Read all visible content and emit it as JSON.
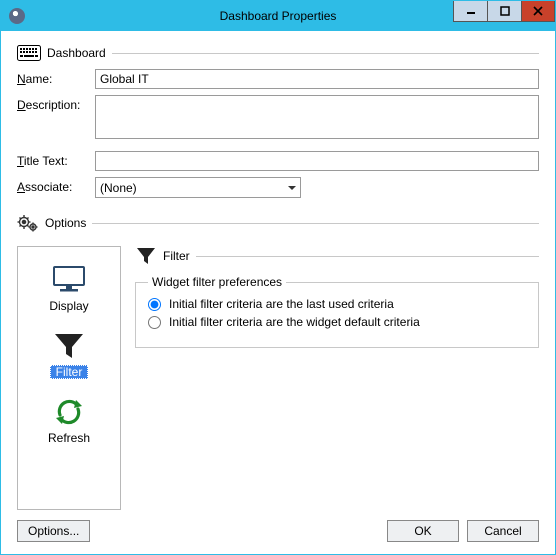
{
  "window": {
    "title": "Dashboard Properties"
  },
  "dashboard_group": {
    "label": "Dashboard",
    "name_label_pre": "N",
    "name_label_post": "ame:",
    "name_value": "Global IT",
    "desc_label_pre": "D",
    "desc_label_post": "escription:",
    "desc_value": "",
    "title_label_pre": "T",
    "title_label_post": "itle Text:",
    "title_value": "",
    "assoc_label_pre": "A",
    "assoc_label_post": "ssociate:",
    "assoc_value": "(None)"
  },
  "options_group": {
    "label": "Options"
  },
  "nav": {
    "display": "Display",
    "filter": "Filter",
    "refresh": "Refresh"
  },
  "filter_section": {
    "header": "Filter",
    "fieldset_label": "Widget filter preferences",
    "radio1": "Initial filter criteria are the last used criteria",
    "radio2": "Initial filter criteria are the widget default criteria"
  },
  "footer": {
    "options_btn": "Options...",
    "ok_btn": "OK",
    "cancel_btn": "Cancel"
  }
}
